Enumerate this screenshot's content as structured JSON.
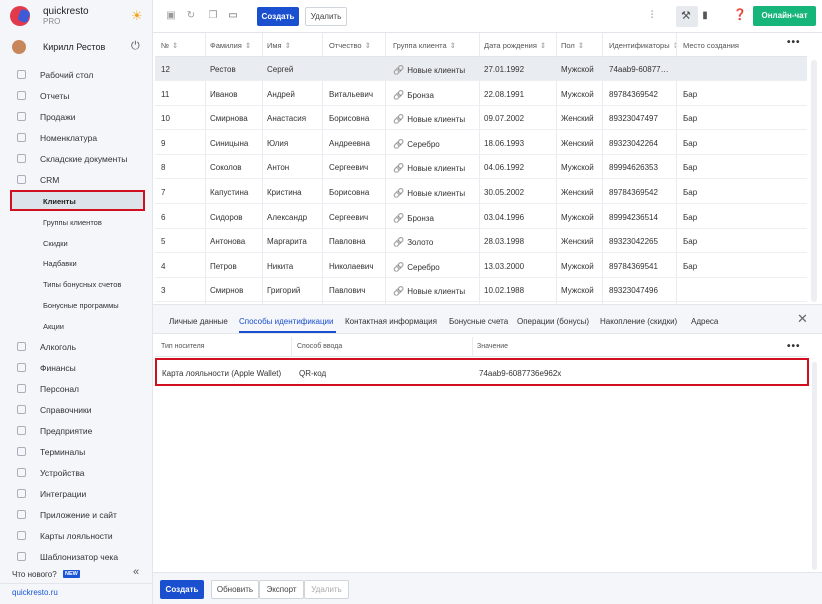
{
  "app": {
    "name": "quickresto",
    "edition": "PRO",
    "site": "quickresto.ru"
  },
  "user": {
    "name": "Кирилл Рестов"
  },
  "sidebar": {
    "items": [
      {
        "label": "Рабочий стол",
        "icon": "dashboard-icon"
      },
      {
        "label": "Отчеты",
        "icon": "reports-icon"
      },
      {
        "label": "Продажи",
        "icon": "sales-icon"
      },
      {
        "label": "Номенклатура",
        "icon": "nomenclature-icon"
      },
      {
        "label": "Складские документы",
        "icon": "warehouse-icon"
      },
      {
        "label": "CRM",
        "icon": "crm-icon"
      }
    ],
    "crm_sub": [
      {
        "label": "Клиенты",
        "active": true
      },
      {
        "label": "Группы клиентов"
      },
      {
        "label": "Скидки"
      },
      {
        "label": "Надбавки"
      },
      {
        "label": "Типы бонусных счетов"
      },
      {
        "label": "Бонусные программы"
      },
      {
        "label": "Акции"
      }
    ],
    "items2": [
      {
        "label": "Алкоголь",
        "icon": "alcohol-icon"
      },
      {
        "label": "Финансы",
        "icon": "finance-icon"
      },
      {
        "label": "Персонал",
        "icon": "staff-icon"
      },
      {
        "label": "Справочники",
        "icon": "directories-icon"
      },
      {
        "label": "Предприятие",
        "icon": "enterprise-icon"
      },
      {
        "label": "Терминалы",
        "icon": "terminals-icon"
      },
      {
        "label": "Устройства",
        "icon": "devices-icon"
      },
      {
        "label": "Интеграции",
        "icon": "integrations-icon"
      },
      {
        "label": "Приложение и сайт",
        "icon": "app-site-icon"
      },
      {
        "label": "Карты лояльности",
        "icon": "loyalty-cards-icon"
      },
      {
        "label": "Шаблонизатор чека",
        "icon": "receipt-template-icon"
      }
    ],
    "whats_new": "Что нового?",
    "new_badge": "NEW"
  },
  "toolbar": {
    "create": "Создать",
    "delete": "Удалить",
    "online_chat": "Онлайн-чат"
  },
  "table": {
    "columns": [
      "№",
      "Фамилия",
      "Имя",
      "Отчество",
      "Группа клиента",
      "Дата рождения",
      "Пол",
      "Идентификаторы",
      "Место создания"
    ],
    "rows": [
      [
        "12",
        "Рестов",
        "Сергей",
        "",
        "Новые клиенты",
        "27.01.1992",
        "Мужской",
        "74aab9-60877…",
        ""
      ],
      [
        "11",
        "Иванов",
        "Андрей",
        "Витальевич",
        "Бронза",
        "22.08.1991",
        "Мужской",
        "89784369542",
        "Бар"
      ],
      [
        "10",
        "Смирнова",
        "Анастасия",
        "Борисовна",
        "Новые клиенты",
        "09.07.2002",
        "Женский",
        "89323047497",
        "Бар"
      ],
      [
        "9",
        "Синицына",
        "Юлия",
        "Андреевна",
        "Серебро",
        "18.06.1993",
        "Женский",
        "89323042264",
        "Бар"
      ],
      [
        "8",
        "Соколов",
        "Антон",
        "Сергеевич",
        "Новые клиенты",
        "04.06.1992",
        "Мужской",
        "89994626353",
        "Бар"
      ],
      [
        "7",
        "Капустина",
        "Кристина",
        "Борисовна",
        "Новые клиенты",
        "30.05.2002",
        "Женский",
        "89784369542",
        "Бар"
      ],
      [
        "6",
        "Сидоров",
        "Александр",
        "Сергеевич",
        "Бронза",
        "03.04.1996",
        "Мужской",
        "89994236514",
        "Бар"
      ],
      [
        "5",
        "Антонова",
        "Маргарита",
        "Павловна",
        "Золото",
        "28.03.1998",
        "Женский",
        "89323042265",
        "Бар"
      ],
      [
        "4",
        "Петров",
        "Никита",
        "Николаевич",
        "Серебро",
        "13.03.2000",
        "Мужской",
        "89784369541",
        "Бар"
      ],
      [
        "3",
        "Смирнов",
        "Григорий",
        "Павлович",
        "Новые клиенты",
        "10.02.1988",
        "Мужской",
        "89323047496",
        ""
      ]
    ]
  },
  "details": {
    "tabs": [
      "Личные данные",
      "Способы идентификации",
      "Контактная информация",
      "Бонусные счета",
      "Операции (бонусы)",
      "Накопление (скидки)",
      "Адреса"
    ],
    "active_tab": 1,
    "columns": [
      "Тип носителя",
      "Способ ввода",
      "Значение"
    ],
    "row": [
      "Карта лояльности (Apple Wallet)",
      "QR-код",
      "74aab9-6087736e962x"
    ]
  },
  "footer": {
    "create": "Создать",
    "refresh": "Обновить",
    "export": "Экспорт",
    "delete": "Удалить"
  },
  "colors": {
    "primary": "#1a4fd0",
    "accent_green": "#16b57a",
    "highlight_red": "#d01020"
  }
}
